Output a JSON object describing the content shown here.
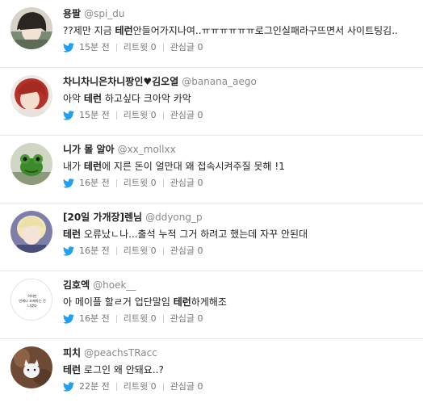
{
  "colors": {
    "bird": "#1da1f2",
    "name": "#222222",
    "handle": "#888888",
    "meta": "#777777",
    "divider": "#e6e6e6"
  },
  "tweets": [
    {
      "name": "용팔",
      "handle": "@spi_du",
      "text_pre": "??제만 지금 ",
      "text_bold": "테런",
      "text_post": "안들어가지나여..ㅠㅠㅠㅠㅠㅠ로그인실패라구뜨면서 사이트팅김..",
      "time": "15분 전",
      "retweet": "리트윗 0",
      "favorite": "관심글 0",
      "avatar_icon": "anime-boy-avatar",
      "avatar_caption": ""
    },
    {
      "name": "차니차니은차니팡인♥김오열",
      "handle": "@banana_aego",
      "text_pre": "아악 ",
      "text_bold": "테런",
      "text_post": " 하고싶다 크아악 카악",
      "time": "15분 전",
      "retweet": "리트윗 0",
      "favorite": "관심글 0",
      "avatar_icon": "red-hair-avatar",
      "avatar_caption": ""
    },
    {
      "name": "니가 몰 알아",
      "handle": "@xx_mollxx",
      "text_pre": "내가 ",
      "text_bold": "테런",
      "text_post": "에 지른 돈이 얼만대 왜 접속시켜주질 못해 !1",
      "time": "16분 전",
      "retweet": "리트윗 0",
      "favorite": "관심글 0",
      "avatar_icon": "frog-avatar",
      "avatar_caption": ""
    },
    {
      "name": "[20일 가개장]렌님",
      "handle": "@ddyong_p",
      "text_pre": "",
      "text_bold": "테런",
      "text_post": " 오류났ㄴ나...출석 누적 그거 하려고 했는데 자꾸 안된대",
      "time": "16분 전",
      "retweet": "리트윗 0",
      "favorite": "관심글 0",
      "avatar_icon": "blonde-avatar",
      "avatar_caption": ""
    },
    {
      "name": "김호엑",
      "handle": "@hoek__",
      "text_pre": "아 메이플 할ㄹ거 업단말임 ",
      "text_bold": "테런",
      "text_post": "하게해조",
      "time": "16분 전",
      "retweet": "리트윗 0",
      "favorite": "관심글 0",
      "avatar_icon": "text-avatar",
      "avatar_caption": "하지만\n언제나 조제하는 건\n나였다"
    },
    {
      "name": "피치",
      "handle": "@peachsTRacc",
      "text_pre": "",
      "text_bold": "테런",
      "text_post": " 로그인 왜 안돼요..?",
      "time": "22분 전",
      "retweet": "리트윗 0",
      "favorite": "관심글 0",
      "avatar_icon": "cat-avatar",
      "avatar_caption": ""
    }
  ]
}
